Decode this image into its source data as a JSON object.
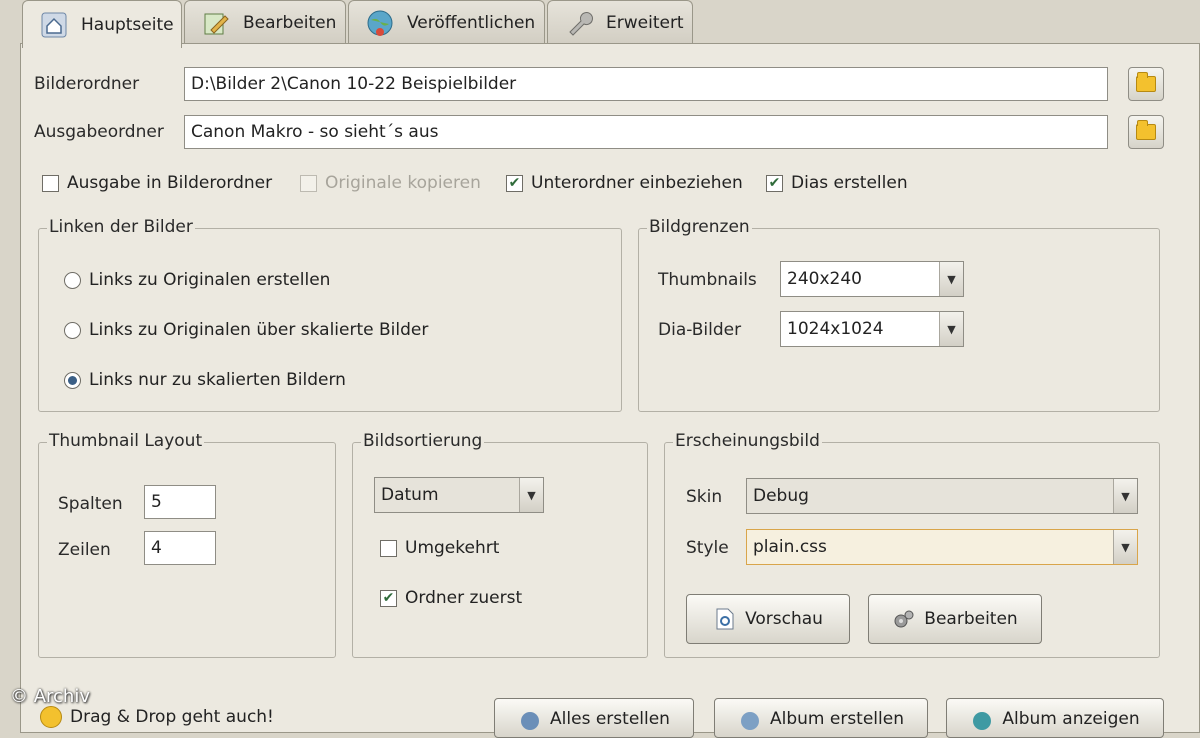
{
  "tabs": [
    {
      "label": "Hauptseite",
      "icon": "house-icon",
      "active": true
    },
    {
      "label": "Bearbeiten",
      "icon": "edit-icon",
      "active": false
    },
    {
      "label": "Veröffentlichen",
      "icon": "globe-icon",
      "active": false
    },
    {
      "label": "Erweitert",
      "icon": "wrench-icon",
      "active": false
    }
  ],
  "folders": {
    "bilderordner_label": "Bilderordner",
    "bilderordner_value": "D:\\Bilder 2\\Canon 10-22 Beispielbilder",
    "ausgabeordner_label": "Ausgabeordner",
    "ausgabeordner_value": "Canon Makro - so sieht´s aus"
  },
  "options": {
    "ausgabe_in_bilderordner": "Ausgabe in Bilderordner",
    "originale_kopieren": "Originale kopieren",
    "unterordner_einbeziehen": "Unterordner einbeziehen",
    "dias_erstellen": "Dias erstellen"
  },
  "linken": {
    "title": "Linken der Bilder",
    "opt1": "Links zu Originalen erstellen",
    "opt2": "Links zu Originalen über skalierte Bilder",
    "opt3": "Links nur zu skalierten Bildern",
    "selected": 3
  },
  "bildgrenzen": {
    "title": "Bildgrenzen",
    "thumbnails_label": "Thumbnails",
    "thumbnails_value": "240x240",
    "dia_label": "Dia-Bilder",
    "dia_value": "1024x1024"
  },
  "thumbnail_layout": {
    "title": "Thumbnail Layout",
    "spalten_label": "Spalten",
    "spalten_value": "5",
    "zeilen_label": "Zeilen",
    "zeilen_value": "4"
  },
  "sortierung": {
    "title": "Bildsortierung",
    "value": "Datum",
    "umgekehrt": "Umgekehrt",
    "ordner_zuerst": "Ordner zuerst"
  },
  "erscheinung": {
    "title": "Erscheinungsbild",
    "skin_label": "Skin",
    "skin_value": "Debug",
    "style_label": "Style",
    "style_value": "plain.css",
    "vorschau": "Vorschau",
    "bearbeiten": "Bearbeiten"
  },
  "footer": {
    "hint": "Drag & Drop geht auch!",
    "btn1": "Alles erstellen",
    "btn2": "Album erstellen",
    "btn3": "Album anzeigen"
  },
  "watermark": "© Archiv",
  "colors": {
    "accent": "#3b5f86",
    "folder": "#f3c12e",
    "check": "#2f6b3a"
  }
}
